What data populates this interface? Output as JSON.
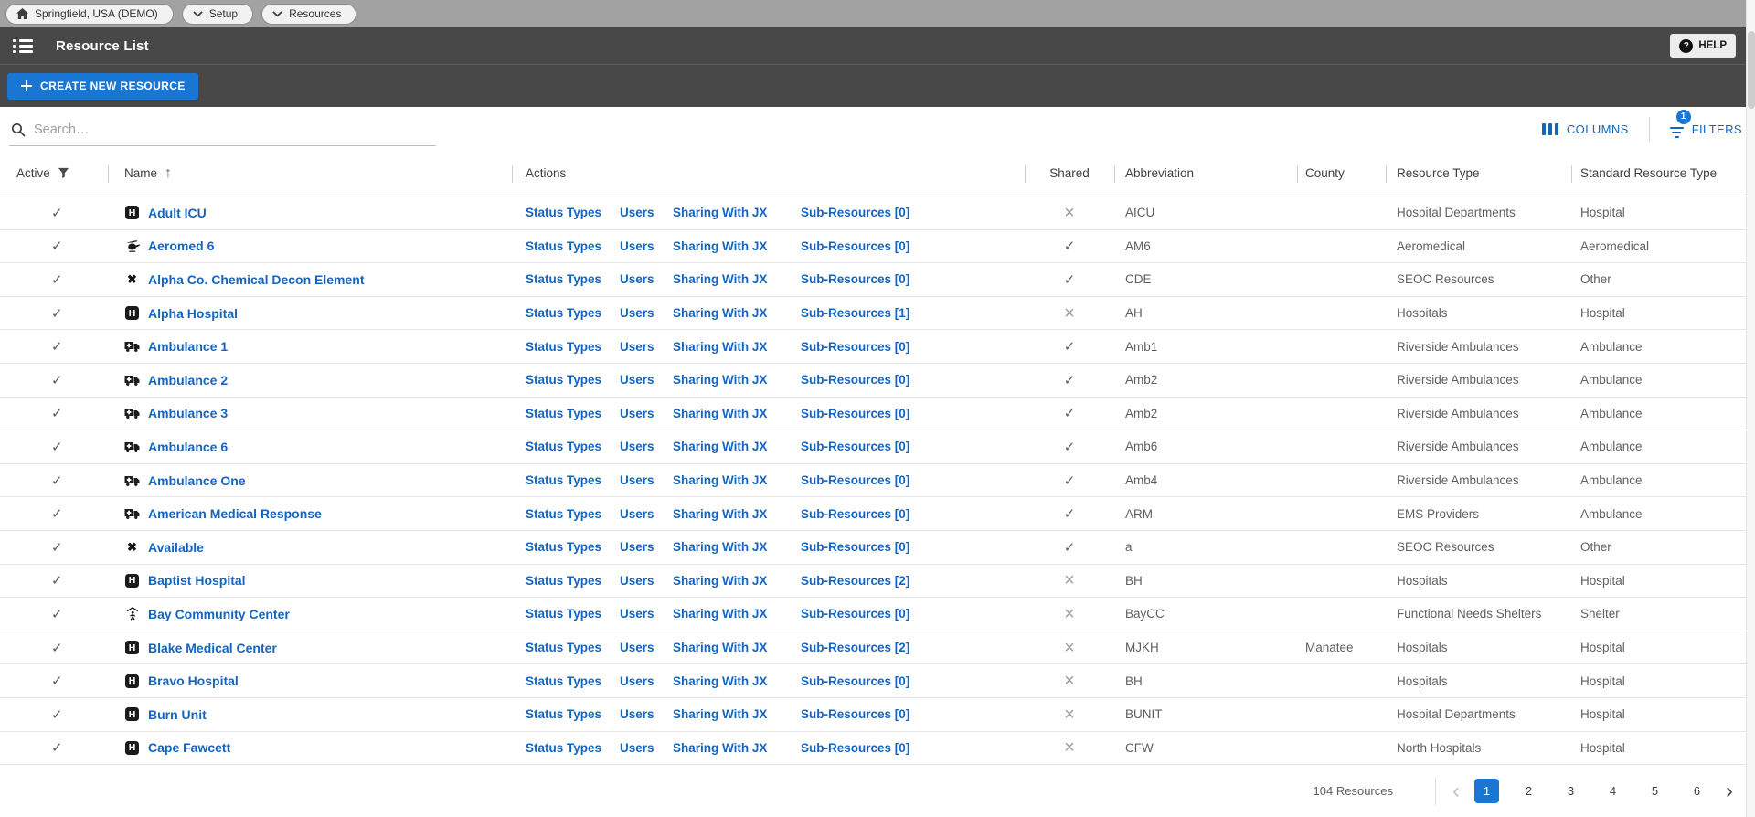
{
  "topbar": {
    "tabs": [
      {
        "label": "Springfield, USA (DEMO)",
        "icon": "home-icon"
      },
      {
        "label": "Setup",
        "icon": "chevron-down-icon"
      },
      {
        "label": "Resources",
        "icon": "chevron-down-icon"
      }
    ]
  },
  "appbar": {
    "title": "Resource List",
    "menu_icon": "list-menu-icon",
    "help_label": "HELP",
    "help_icon": "question-mark-icon"
  },
  "toolbar": {
    "create_label": "CREATE NEW RESOURCE",
    "create_icon": "plus-icon"
  },
  "controls": {
    "search_placeholder": "Search…",
    "search_icon": "search-icon",
    "columns_label": "COLUMNS",
    "columns_icon": "columns-icon",
    "filters_label": "FILTERS",
    "filters_icon": "filter-icon",
    "filters_badge": "1"
  },
  "table": {
    "columns": [
      {
        "label": "Active",
        "icon": "filter-funnel-icon"
      },
      {
        "label": "Name",
        "icon": "sort-ascending-icon",
        "sort_glyph": "↑"
      },
      {
        "label": "Actions"
      },
      {
        "label": "Shared"
      },
      {
        "label": "Abbreviation"
      },
      {
        "label": "County"
      },
      {
        "label": "Resource Type"
      },
      {
        "label": "Standard Resource Type"
      }
    ],
    "action_labels": [
      "Status Types",
      "Users",
      "Sharing With JX"
    ],
    "rows": [
      {
        "active": true,
        "icon": "hospital-icon",
        "name": "Adult ICU",
        "sub_resources": "Sub-Resources [0]",
        "shared": false,
        "abbreviation": "AICU",
        "county": "",
        "resource_type": "Hospital Departments",
        "standard_resource_type": "Hospital"
      },
      {
        "active": true,
        "icon": "helicopter-icon",
        "name": "Aeromed 6",
        "sub_resources": "Sub-Resources [0]",
        "shared": true,
        "abbreviation": "AM6",
        "county": "",
        "resource_type": "Aeromedical",
        "standard_resource_type": "Aeromedical"
      },
      {
        "active": true,
        "icon": "x-icon",
        "name": "Alpha Co. Chemical Decon Element",
        "sub_resources": "Sub-Resources [0]",
        "shared": true,
        "abbreviation": "CDE",
        "county": "",
        "resource_type": "SEOC Resources",
        "standard_resource_type": "Other"
      },
      {
        "active": true,
        "icon": "hospital-icon",
        "name": "Alpha Hospital",
        "sub_resources": "Sub-Resources [1]",
        "shared": false,
        "abbreviation": "AH",
        "county": "",
        "resource_type": "Hospitals",
        "standard_resource_type": "Hospital"
      },
      {
        "active": true,
        "icon": "ambulance-icon",
        "name": "Ambulance 1",
        "sub_resources": "Sub-Resources [0]",
        "shared": true,
        "abbreviation": "Amb1",
        "county": "",
        "resource_type": "Riverside Ambulances",
        "standard_resource_type": "Ambulance"
      },
      {
        "active": true,
        "icon": "ambulance-icon",
        "name": "Ambulance 2",
        "sub_resources": "Sub-Resources [0]",
        "shared": true,
        "abbreviation": "Amb2",
        "county": "",
        "resource_type": "Riverside Ambulances",
        "standard_resource_type": "Ambulance"
      },
      {
        "active": true,
        "icon": "ambulance-icon",
        "name": "Ambulance 3",
        "sub_resources": "Sub-Resources [0]",
        "shared": true,
        "abbreviation": "Amb2",
        "county": "",
        "resource_type": "Riverside Ambulances",
        "standard_resource_type": "Ambulance"
      },
      {
        "active": true,
        "icon": "ambulance-icon",
        "name": "Ambulance 6",
        "sub_resources": "Sub-Resources [0]",
        "shared": true,
        "abbreviation": "Amb6",
        "county": "",
        "resource_type": "Riverside Ambulances",
        "standard_resource_type": "Ambulance"
      },
      {
        "active": true,
        "icon": "ambulance-icon",
        "name": "Ambulance One",
        "sub_resources": "Sub-Resources [0]",
        "shared": true,
        "abbreviation": "Amb4",
        "county": "",
        "resource_type": "Riverside Ambulances",
        "standard_resource_type": "Ambulance"
      },
      {
        "active": true,
        "icon": "ambulance-icon",
        "name": "American Medical Response",
        "sub_resources": "Sub-Resources [0]",
        "shared": true,
        "abbreviation": "ARM",
        "county": "",
        "resource_type": "EMS Providers",
        "standard_resource_type": "Ambulance"
      },
      {
        "active": true,
        "icon": "x-icon",
        "name": "Available",
        "sub_resources": "Sub-Resources [0]",
        "shared": true,
        "abbreviation": "a",
        "county": "",
        "resource_type": "SEOC Resources",
        "standard_resource_type": "Other"
      },
      {
        "active": true,
        "icon": "hospital-icon",
        "name": "Baptist Hospital",
        "sub_resources": "Sub-Resources [2]",
        "shared": false,
        "abbreviation": "BH",
        "county": "",
        "resource_type": "Hospitals",
        "standard_resource_type": "Hospital"
      },
      {
        "active": true,
        "icon": "shelter-icon",
        "name": "Bay Community Center",
        "sub_resources": "Sub-Resources [0]",
        "shared": false,
        "abbreviation": "BayCC",
        "county": "",
        "resource_type": "Functional Needs Shelters",
        "standard_resource_type": "Shelter"
      },
      {
        "active": true,
        "icon": "hospital-icon",
        "name": "Blake Medical Center",
        "sub_resources": "Sub-Resources [2]",
        "shared": false,
        "abbreviation": "MJKH",
        "county": "Manatee",
        "resource_type": "Hospitals",
        "standard_resource_type": "Hospital"
      },
      {
        "active": true,
        "icon": "hospital-icon",
        "name": "Bravo Hospital",
        "sub_resources": "Sub-Resources [0]",
        "shared": false,
        "abbreviation": "BH",
        "county": "",
        "resource_type": "Hospitals",
        "standard_resource_type": "Hospital"
      },
      {
        "active": true,
        "icon": "hospital-icon",
        "name": "Burn Unit",
        "sub_resources": "Sub-Resources [0]",
        "shared": false,
        "abbreviation": "BUNIT",
        "county": "",
        "resource_type": "Hospital Departments",
        "standard_resource_type": "Hospital"
      },
      {
        "active": true,
        "icon": "hospital-icon",
        "name": "Cape Fawcett",
        "sub_resources": "Sub-Resources [0]",
        "shared": false,
        "abbreviation": "CFW",
        "county": "",
        "resource_type": "North Hospitals",
        "standard_resource_type": "Hospital"
      }
    ],
    "shared_yes_glyph": "✓",
    "shared_no_glyph": "×",
    "active_glyph": "✓"
  },
  "footer": {
    "count": "104 Resources",
    "prev_icon": "chevron-left-icon",
    "next_icon": "chevron-right-icon",
    "prev_glyph": "‹",
    "next_glyph": "›",
    "pages": [
      "1",
      "2",
      "3",
      "4",
      "5",
      "6"
    ],
    "active_page": "1"
  },
  "colors": {
    "accent_blue": "#1976d2",
    "link_blue": "#1565c0",
    "appbar_dark": "#484848",
    "topbar_gray": "#a2a2a2"
  }
}
